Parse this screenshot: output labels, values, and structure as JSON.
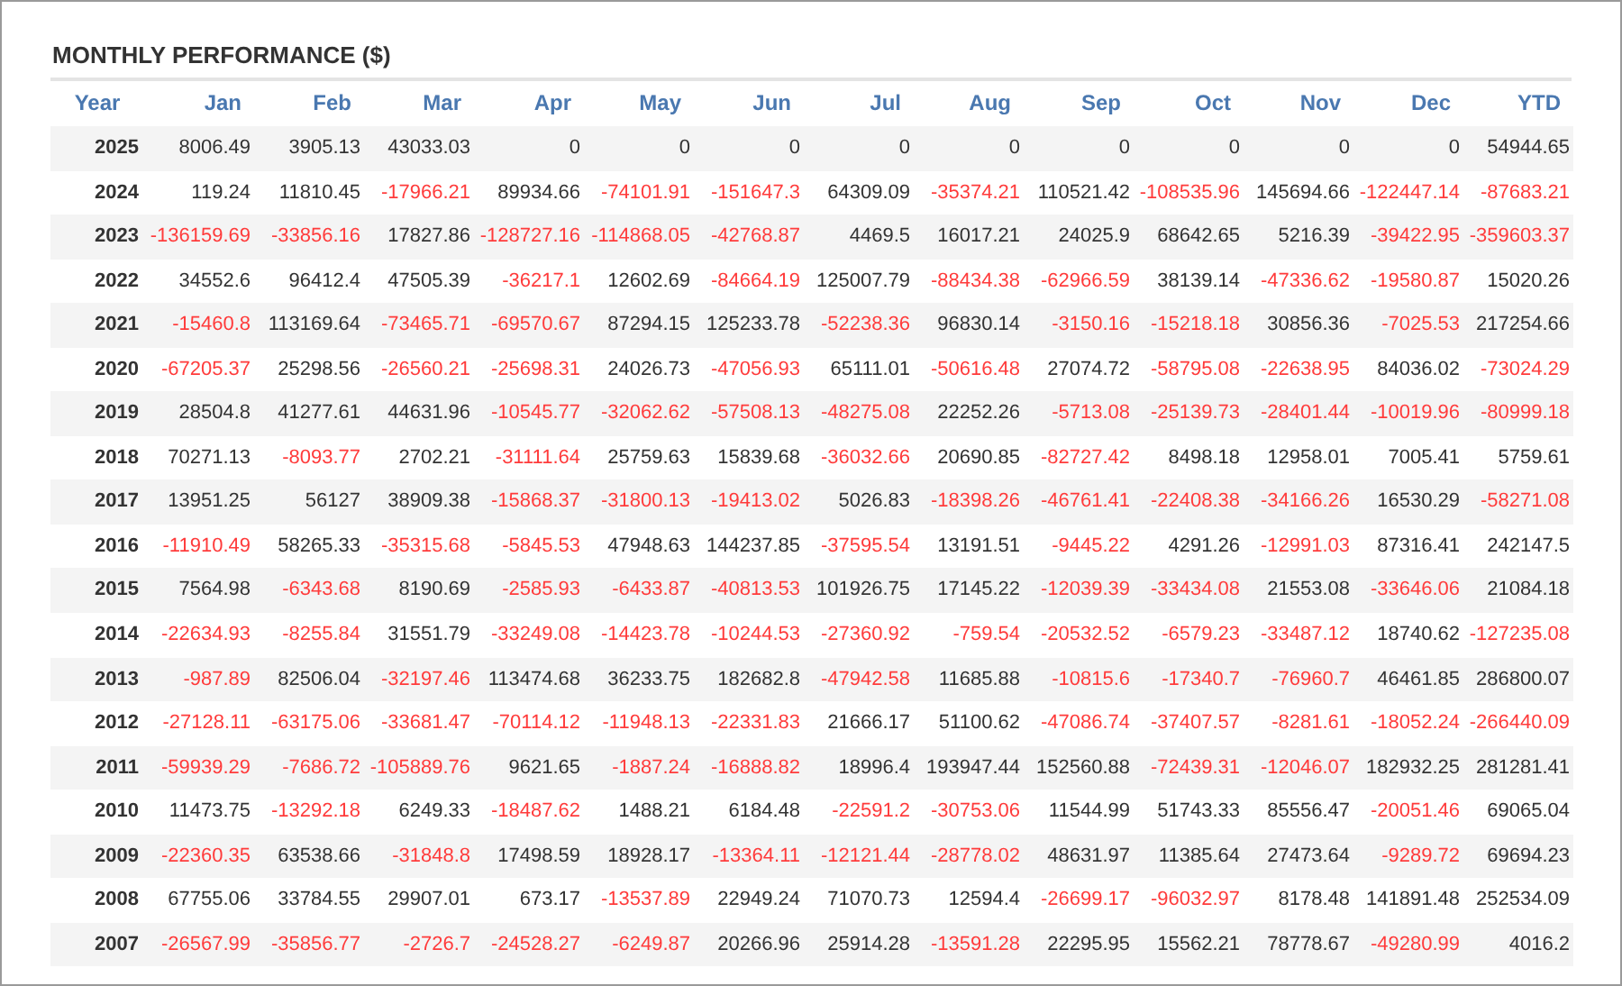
{
  "title": "MONTHLY PERFORMANCE ($)",
  "columns": [
    "Year",
    "Jan",
    "Feb",
    "Mar",
    "Apr",
    "May",
    "Jun",
    "Jul",
    "Aug",
    "Sep",
    "Oct",
    "Nov",
    "Dec",
    "YTD"
  ],
  "rows": [
    {
      "year": "2025",
      "cells": [
        {
          "v": "8006.49",
          "negative": false
        },
        {
          "v": "3905.13",
          "negative": false
        },
        {
          "v": "43033.03",
          "negative": false
        },
        {
          "v": "0",
          "negative": false
        },
        {
          "v": "0",
          "negative": false
        },
        {
          "v": "0",
          "negative": false
        },
        {
          "v": "0",
          "negative": false
        },
        {
          "v": "0",
          "negative": false
        },
        {
          "v": "0",
          "negative": false
        },
        {
          "v": "0",
          "negative": false
        },
        {
          "v": "0",
          "negative": false
        },
        {
          "v": "0",
          "negative": false
        },
        {
          "v": "54944.65",
          "negative": false
        }
      ]
    },
    {
      "year": "2024",
      "cells": [
        {
          "v": "119.24",
          "negative": false
        },
        {
          "v": "11810.45",
          "negative": false
        },
        {
          "v": "-17966.21",
          "negative": true
        },
        {
          "v": "89934.66",
          "negative": false
        },
        {
          "v": "-74101.91",
          "negative": true
        },
        {
          "v": "-151647.3",
          "negative": true
        },
        {
          "v": "64309.09",
          "negative": false
        },
        {
          "v": "-35374.21",
          "negative": true
        },
        {
          "v": "110521.42",
          "negative": false
        },
        {
          "v": "-108535.96",
          "negative": true
        },
        {
          "v": "145694.66",
          "negative": false
        },
        {
          "v": "-122447.14",
          "negative": true
        },
        {
          "v": "-87683.21",
          "negative": true
        }
      ]
    },
    {
      "year": "2023",
      "cells": [
        {
          "v": "-136159.69",
          "negative": true
        },
        {
          "v": "-33856.16",
          "negative": true
        },
        {
          "v": "17827.86",
          "negative": false
        },
        {
          "v": "-128727.16",
          "negative": true
        },
        {
          "v": "-114868.05",
          "negative": true
        },
        {
          "v": "-42768.87",
          "negative": true
        },
        {
          "v": "4469.5",
          "negative": false
        },
        {
          "v": "16017.21",
          "negative": false
        },
        {
          "v": "24025.9",
          "negative": false
        },
        {
          "v": "68642.65",
          "negative": false
        },
        {
          "v": "5216.39",
          "negative": false
        },
        {
          "v": "-39422.95",
          "negative": true
        },
        {
          "v": "-359603.37",
          "negative": true
        }
      ]
    },
    {
      "year": "2022",
      "cells": [
        {
          "v": "34552.6",
          "negative": false
        },
        {
          "v": "96412.4",
          "negative": false
        },
        {
          "v": "47505.39",
          "negative": false
        },
        {
          "v": "-36217.1",
          "negative": true
        },
        {
          "v": "12602.69",
          "negative": false
        },
        {
          "v": "-84664.19",
          "negative": true
        },
        {
          "v": "125007.79",
          "negative": false
        },
        {
          "v": "-88434.38",
          "negative": true
        },
        {
          "v": "-62966.59",
          "negative": true
        },
        {
          "v": "38139.14",
          "negative": false
        },
        {
          "v": "-47336.62",
          "negative": true
        },
        {
          "v": "-19580.87",
          "negative": true
        },
        {
          "v": "15020.26",
          "negative": false
        }
      ]
    },
    {
      "year": "2021",
      "cells": [
        {
          "v": "-15460.8",
          "negative": true
        },
        {
          "v": "113169.64",
          "negative": false
        },
        {
          "v": "-73465.71",
          "negative": true
        },
        {
          "v": "-69570.67",
          "negative": true
        },
        {
          "v": "87294.15",
          "negative": false
        },
        {
          "v": "125233.78",
          "negative": false
        },
        {
          "v": "-52238.36",
          "negative": true
        },
        {
          "v": "96830.14",
          "negative": false
        },
        {
          "v": "-3150.16",
          "negative": true
        },
        {
          "v": "-15218.18",
          "negative": true
        },
        {
          "v": "30856.36",
          "negative": false
        },
        {
          "v": "-7025.53",
          "negative": true
        },
        {
          "v": "217254.66",
          "negative": false
        }
      ]
    },
    {
      "year": "2020",
      "cells": [
        {
          "v": "-67205.37",
          "negative": true
        },
        {
          "v": "25298.56",
          "negative": false
        },
        {
          "v": "-26560.21",
          "negative": true
        },
        {
          "v": "-25698.31",
          "negative": true
        },
        {
          "v": "24026.73",
          "negative": false
        },
        {
          "v": "-47056.93",
          "negative": true
        },
        {
          "v": "65111.01",
          "negative": false
        },
        {
          "v": "-50616.48",
          "negative": true
        },
        {
          "v": "27074.72",
          "negative": false
        },
        {
          "v": "-58795.08",
          "negative": true
        },
        {
          "v": "-22638.95",
          "negative": true
        },
        {
          "v": "84036.02",
          "negative": false
        },
        {
          "v": "-73024.29",
          "negative": true
        }
      ]
    },
    {
      "year": "2019",
      "cells": [
        {
          "v": "28504.8",
          "negative": false
        },
        {
          "v": "41277.61",
          "negative": false
        },
        {
          "v": "44631.96",
          "negative": false
        },
        {
          "v": "-10545.77",
          "negative": true
        },
        {
          "v": "-32062.62",
          "negative": true
        },
        {
          "v": "-57508.13",
          "negative": true
        },
        {
          "v": "-48275.08",
          "negative": true
        },
        {
          "v": "22252.26",
          "negative": false
        },
        {
          "v": "-5713.08",
          "negative": true
        },
        {
          "v": "-25139.73",
          "negative": true
        },
        {
          "v": "-28401.44",
          "negative": true
        },
        {
          "v": "-10019.96",
          "negative": true
        },
        {
          "v": "-80999.18",
          "negative": true
        }
      ]
    },
    {
      "year": "2018",
      "cells": [
        {
          "v": "70271.13",
          "negative": false
        },
        {
          "v": "-8093.77",
          "negative": true
        },
        {
          "v": "2702.21",
          "negative": false
        },
        {
          "v": "-31111.64",
          "negative": true
        },
        {
          "v": "25759.63",
          "negative": false
        },
        {
          "v": "15839.68",
          "negative": false
        },
        {
          "v": "-36032.66",
          "negative": true
        },
        {
          "v": "20690.85",
          "negative": false
        },
        {
          "v": "-82727.42",
          "negative": true
        },
        {
          "v": "8498.18",
          "negative": false
        },
        {
          "v": "12958.01",
          "negative": false
        },
        {
          "v": "7005.41",
          "negative": false
        },
        {
          "v": "5759.61",
          "negative": false
        }
      ]
    },
    {
      "year": "2017",
      "cells": [
        {
          "v": "13951.25",
          "negative": false
        },
        {
          "v": "56127",
          "negative": false
        },
        {
          "v": "38909.38",
          "negative": false
        },
        {
          "v": "-15868.37",
          "negative": true
        },
        {
          "v": "-31800.13",
          "negative": true
        },
        {
          "v": "-19413.02",
          "negative": true
        },
        {
          "v": "5026.83",
          "negative": false
        },
        {
          "v": "-18398.26",
          "negative": true
        },
        {
          "v": "-46761.41",
          "negative": true
        },
        {
          "v": "-22408.38",
          "negative": true
        },
        {
          "v": "-34166.26",
          "negative": true
        },
        {
          "v": "16530.29",
          "negative": false
        },
        {
          "v": "-58271.08",
          "negative": true
        }
      ]
    },
    {
      "year": "2016",
      "cells": [
        {
          "v": "-11910.49",
          "negative": true
        },
        {
          "v": "58265.33",
          "negative": false
        },
        {
          "v": "-35315.68",
          "negative": true
        },
        {
          "v": "-5845.53",
          "negative": true
        },
        {
          "v": "47948.63",
          "negative": false
        },
        {
          "v": "144237.85",
          "negative": false
        },
        {
          "v": "-37595.54",
          "negative": true
        },
        {
          "v": "13191.51",
          "negative": false
        },
        {
          "v": "-9445.22",
          "negative": true
        },
        {
          "v": "4291.26",
          "negative": false
        },
        {
          "v": "-12991.03",
          "negative": true
        },
        {
          "v": "87316.41",
          "negative": false
        },
        {
          "v": "242147.5",
          "negative": false
        }
      ]
    },
    {
      "year": "2015",
      "cells": [
        {
          "v": "7564.98",
          "negative": false
        },
        {
          "v": "-6343.68",
          "negative": true
        },
        {
          "v": "8190.69",
          "negative": false
        },
        {
          "v": "-2585.93",
          "negative": true
        },
        {
          "v": "-6433.87",
          "negative": true
        },
        {
          "v": "-40813.53",
          "negative": true
        },
        {
          "v": "101926.75",
          "negative": false
        },
        {
          "v": "17145.22",
          "negative": false
        },
        {
          "v": "-12039.39",
          "negative": true
        },
        {
          "v": "-33434.08",
          "negative": true
        },
        {
          "v": "21553.08",
          "negative": false
        },
        {
          "v": "-33646.06",
          "negative": true
        },
        {
          "v": "21084.18",
          "negative": false
        }
      ]
    },
    {
      "year": "2014",
      "cells": [
        {
          "v": "-22634.93",
          "negative": true
        },
        {
          "v": "-8255.84",
          "negative": true
        },
        {
          "v": "31551.79",
          "negative": false
        },
        {
          "v": "-33249.08",
          "negative": true
        },
        {
          "v": "-14423.78",
          "negative": true
        },
        {
          "v": "-10244.53",
          "negative": true
        },
        {
          "v": "-27360.92",
          "negative": true
        },
        {
          "v": "-759.54",
          "negative": true
        },
        {
          "v": "-20532.52",
          "negative": true
        },
        {
          "v": "-6579.23",
          "negative": true
        },
        {
          "v": "-33487.12",
          "negative": true
        },
        {
          "v": "18740.62",
          "negative": false
        },
        {
          "v": "-127235.08",
          "negative": true
        }
      ]
    },
    {
      "year": "2013",
      "cells": [
        {
          "v": "-987.89",
          "negative": true
        },
        {
          "v": "82506.04",
          "negative": false
        },
        {
          "v": "-32197.46",
          "negative": true
        },
        {
          "v": "113474.68",
          "negative": false
        },
        {
          "v": "36233.75",
          "negative": false
        },
        {
          "v": "182682.8",
          "negative": false
        },
        {
          "v": "-47942.58",
          "negative": true
        },
        {
          "v": "11685.88",
          "negative": false
        },
        {
          "v": "-10815.6",
          "negative": true
        },
        {
          "v": "-17340.7",
          "negative": true
        },
        {
          "v": "-76960.7",
          "negative": true
        },
        {
          "v": "46461.85",
          "negative": false
        },
        {
          "v": "286800.07",
          "negative": false
        }
      ]
    },
    {
      "year": "2012",
      "cells": [
        {
          "v": "-27128.11",
          "negative": true
        },
        {
          "v": "-63175.06",
          "negative": true
        },
        {
          "v": "-33681.47",
          "negative": true
        },
        {
          "v": "-70114.12",
          "negative": true
        },
        {
          "v": "-11948.13",
          "negative": true
        },
        {
          "v": "-22331.83",
          "negative": true
        },
        {
          "v": "21666.17",
          "negative": false
        },
        {
          "v": "51100.62",
          "negative": false
        },
        {
          "v": "-47086.74",
          "negative": true
        },
        {
          "v": "-37407.57",
          "negative": true
        },
        {
          "v": "-8281.61",
          "negative": true
        },
        {
          "v": "-18052.24",
          "negative": true
        },
        {
          "v": "-266440.09",
          "negative": true
        }
      ]
    },
    {
      "year": "2011",
      "cells": [
        {
          "v": "-59939.29",
          "negative": true
        },
        {
          "v": "-7686.72",
          "negative": true
        },
        {
          "v": "-105889.76",
          "negative": true
        },
        {
          "v": "9621.65",
          "negative": false
        },
        {
          "v": "-1887.24",
          "negative": true
        },
        {
          "v": "-16888.82",
          "negative": true
        },
        {
          "v": "18996.4",
          "negative": false
        },
        {
          "v": "193947.44",
          "negative": false
        },
        {
          "v": "152560.88",
          "negative": false
        },
        {
          "v": "-72439.31",
          "negative": true
        },
        {
          "v": "-12046.07",
          "negative": true
        },
        {
          "v": "182932.25",
          "negative": false
        },
        {
          "v": "281281.41",
          "negative": false
        }
      ]
    },
    {
      "year": "2010",
      "cells": [
        {
          "v": "11473.75",
          "negative": false
        },
        {
          "v": "-13292.18",
          "negative": true
        },
        {
          "v": "6249.33",
          "negative": false
        },
        {
          "v": "-18487.62",
          "negative": true
        },
        {
          "v": "1488.21",
          "negative": false
        },
        {
          "v": "6184.48",
          "negative": false
        },
        {
          "v": "-22591.2",
          "negative": true
        },
        {
          "v": "-30753.06",
          "negative": true
        },
        {
          "v": "11544.99",
          "negative": false
        },
        {
          "v": "51743.33",
          "negative": false
        },
        {
          "v": "85556.47",
          "negative": false
        },
        {
          "v": "-20051.46",
          "negative": true
        },
        {
          "v": "69065.04",
          "negative": false
        }
      ]
    },
    {
      "year": "2009",
      "cells": [
        {
          "v": "-22360.35",
          "negative": true
        },
        {
          "v": "63538.66",
          "negative": false
        },
        {
          "v": "-31848.8",
          "negative": true
        },
        {
          "v": "17498.59",
          "negative": false
        },
        {
          "v": "18928.17",
          "negative": false
        },
        {
          "v": "-13364.11",
          "negative": true
        },
        {
          "v": "-12121.44",
          "negative": true
        },
        {
          "v": "-28778.02",
          "negative": true
        },
        {
          "v": "48631.97",
          "negative": false
        },
        {
          "v": "11385.64",
          "negative": false
        },
        {
          "v": "27473.64",
          "negative": false
        },
        {
          "v": "-9289.72",
          "negative": true
        },
        {
          "v": "69694.23",
          "negative": false
        }
      ]
    },
    {
      "year": "2008",
      "cells": [
        {
          "v": "67755.06",
          "negative": false
        },
        {
          "v": "33784.55",
          "negative": false
        },
        {
          "v": "29907.01",
          "negative": false
        },
        {
          "v": "673.17",
          "negative": false
        },
        {
          "v": "-13537.89",
          "negative": true
        },
        {
          "v": "22949.24",
          "negative": false
        },
        {
          "v": "71070.73",
          "negative": false
        },
        {
          "v": "12594.4",
          "negative": false
        },
        {
          "v": "-26699.17",
          "negative": true
        },
        {
          "v": "-96032.97",
          "negative": true
        },
        {
          "v": "8178.48",
          "negative": false
        },
        {
          "v": "141891.48",
          "negative": false
        },
        {
          "v": "252534.09",
          "negative": false
        }
      ]
    },
    {
      "year": "2007",
      "cells": [
        {
          "v": "-26567.99",
          "negative": true
        },
        {
          "v": "-35856.77",
          "negative": true
        },
        {
          "v": "-2726.7",
          "negative": true
        },
        {
          "v": "-24528.27",
          "negative": true
        },
        {
          "v": "-6249.87",
          "negative": true
        },
        {
          "v": "20266.96",
          "negative": false
        },
        {
          "v": "25914.28",
          "negative": false
        },
        {
          "v": "-13591.28",
          "negative": true
        },
        {
          "v": "22295.95",
          "negative": false
        },
        {
          "v": "15562.21",
          "negative": false
        },
        {
          "v": "78778.67",
          "negative": false
        },
        {
          "v": "-49280.99",
          "negative": true
        },
        {
          "v": "4016.2",
          "negative": false
        }
      ]
    }
  ]
}
